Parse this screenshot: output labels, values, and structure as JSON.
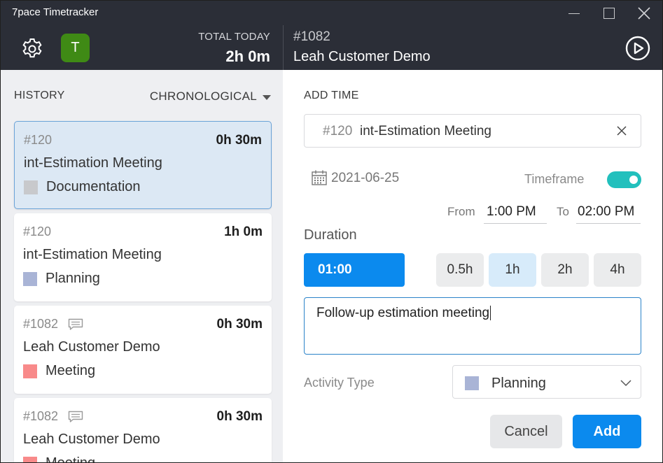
{
  "window": {
    "title": "7pace Timetracker",
    "controls": {
      "minimize": "minimize-icon",
      "maximize": "maximize-icon",
      "close": "close-icon"
    }
  },
  "header": {
    "settings_icon": "gear-icon",
    "avatar_initial": "T",
    "avatar_color": "#3f8a15",
    "total_label": "TOTAL TODAY",
    "total_value": "2h 0m",
    "work_item_id": "#1082",
    "work_item_title": "Leah Customer Demo",
    "play_icon": "play-circle-icon",
    "background": "#2b2e37"
  },
  "history": {
    "label": "HISTORY",
    "sort_label": "CHRONOLOGICAL",
    "entries": [
      {
        "id": "#120",
        "duration": "0h 30m",
        "title": "int-Estimation Meeting",
        "activity": "Documentation",
        "activity_color": "#c8c9cc",
        "has_comment": false,
        "selected": true
      },
      {
        "id": "#120",
        "duration": "1h 0m",
        "title": "int-Estimation Meeting",
        "activity": "Planning",
        "activity_color": "#a9b4d6",
        "has_comment": false,
        "selected": false
      },
      {
        "id": "#1082",
        "duration": "0h 30m",
        "title": "Leah Customer Demo",
        "activity": "Meeting",
        "activity_color": "#f88a8a",
        "has_comment": true,
        "selected": false
      },
      {
        "id": "#1082",
        "duration": "0h 30m",
        "title": "Leah Customer Demo",
        "activity": "Meeting",
        "activity_color": "#f88a8a",
        "has_comment": true,
        "selected": false
      }
    ]
  },
  "add_time": {
    "label": "ADD TIME",
    "work_item_number": "#120",
    "work_item_name": "int-Estimation Meeting",
    "date": "2021-06-25",
    "timeframe_label": "Timeframe",
    "timeframe_on": true,
    "from_label": "From",
    "from_value": "1:00 PM",
    "to_label": "To",
    "to_value": "02:00 PM",
    "duration_label": "Duration",
    "duration_value": "01:00",
    "quick_durations": [
      "0.5h",
      "1h",
      "2h",
      "4h"
    ],
    "active_quick_duration": "1h",
    "comment": "Follow-up estimation meeting",
    "activity_label": "Activity Type",
    "activity_value": "Planning",
    "activity_color": "#a9b4d6",
    "cancel_label": "Cancel",
    "add_label": "Add",
    "accent_color": "#0b8aee",
    "toggle_color": "#22c0bd"
  }
}
